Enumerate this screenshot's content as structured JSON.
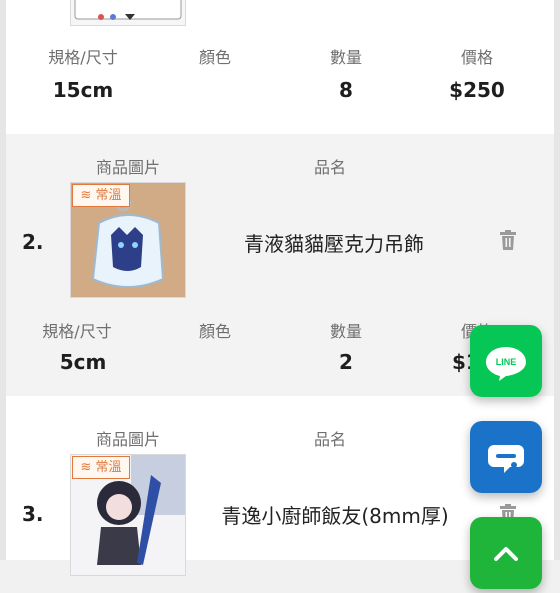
{
  "labels": {
    "image_header": "商品圖片",
    "name_header": "品名",
    "spec_header": "規格/尺寸",
    "color_header": "顏色",
    "qty_header": "數量",
    "price_header": "價格"
  },
  "items": [
    {
      "index": "",
      "name": "",
      "tag": "",
      "spec": "15cm",
      "color": "",
      "qty": "8",
      "price": "$250"
    },
    {
      "index": "2.",
      "name": "青液貓貓壓克力吊飾",
      "tag": "常溫",
      "spec": "5cm",
      "color": "",
      "qty": "2",
      "price": "$1"
    },
    {
      "index": "3.",
      "name": "青逸小廚師飯友(8mm厚)",
      "tag": "常溫",
      "spec": "",
      "color": "",
      "qty": "",
      "price": ""
    }
  ],
  "fabs": {
    "line_label": "LINE",
    "line_color": "#06c755",
    "chat_color": "#1a73c9",
    "top_color": "#1fb53a"
  },
  "icons": [
    "trash-icon",
    "line-icon",
    "chat-icon",
    "chevron-up-icon"
  ]
}
